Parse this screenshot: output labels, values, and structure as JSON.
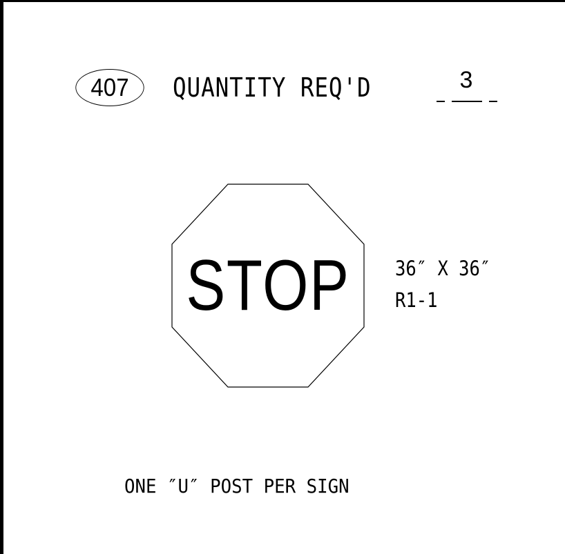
{
  "callout": {
    "number": "407"
  },
  "quantity": {
    "label": "QUANTITY REQ'D",
    "value": "3"
  },
  "sign": {
    "legend": "STOP",
    "size": "36″ X 36″",
    "code": "R1-1"
  },
  "note": "ONE ″U″ POST PER SIGN",
  "colors": {
    "line": "#000000",
    "background": "#ffffff"
  }
}
